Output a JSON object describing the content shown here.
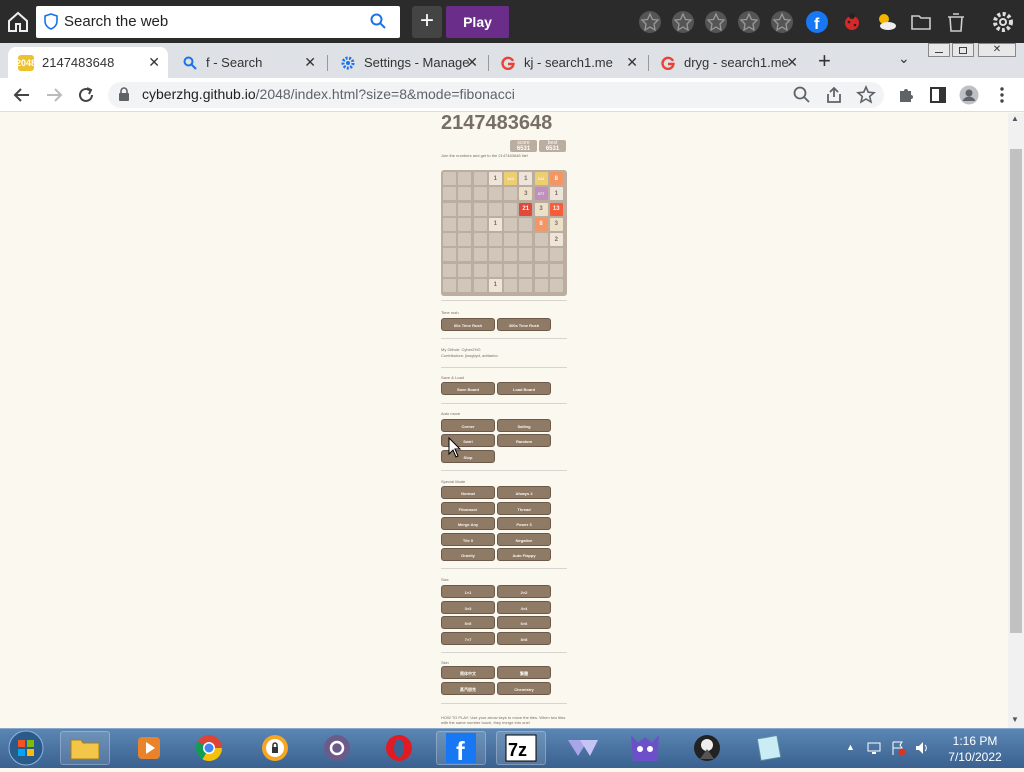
{
  "search_bar": {
    "placeholder": "Search the web",
    "play_label": "Play"
  },
  "tabs": [
    {
      "title": "2147483648",
      "icon": "2048-icon"
    },
    {
      "title": "f - Search",
      "icon": "search-icon"
    },
    {
      "title": "Settings - Manage",
      "icon": "settings-gear-icon"
    },
    {
      "title": "kj - search1.me",
      "icon": "google-icon"
    },
    {
      "title": "dryg - search1.me",
      "icon": "google-icon"
    }
  ],
  "address": {
    "domain": "cyberzhg.github.io",
    "path": "/2048/index.html?size=8&mode=fibonacci"
  },
  "game": {
    "title": "2147483648",
    "score_label": "score",
    "score": "6531",
    "best_label": "best",
    "best": "6531",
    "intro": "Join the numbers and get to the 2147483648 tile!",
    "board_size": 8,
    "tiles": [
      {
        "r": 0,
        "c": 3,
        "v": "1"
      },
      {
        "r": 0,
        "c": 4,
        "v": "144"
      },
      {
        "r": 0,
        "c": 5,
        "v": "1"
      },
      {
        "r": 0,
        "c": 6,
        "v": "144"
      },
      {
        "r": 0,
        "c": 7,
        "v": "8"
      },
      {
        "r": 1,
        "c": 5,
        "v": "3"
      },
      {
        "r": 1,
        "c": 6,
        "v": "377"
      },
      {
        "r": 1,
        "c": 7,
        "v": "1"
      },
      {
        "r": 2,
        "c": 5,
        "v": "21"
      },
      {
        "r": 2,
        "c": 6,
        "v": "3"
      },
      {
        "r": 2,
        "c": 7,
        "v": "13"
      },
      {
        "r": 3,
        "c": 3,
        "v": "1"
      },
      {
        "r": 3,
        "c": 6,
        "v": "8"
      },
      {
        "r": 3,
        "c": 7,
        "v": "3"
      },
      {
        "r": 4,
        "c": 7,
        "v": "2"
      },
      {
        "r": 7,
        "c": 3,
        "v": "1"
      }
    ],
    "time_rush": {
      "label": "Time rush",
      "buttons": [
        "60s Time Rush",
        "300s Time Rush"
      ]
    },
    "github": {
      "line1": "My Github: CyberZHG",
      "line2": "Contributors: jlongbyd, adrianbo"
    },
    "save_load": {
      "label": "Save & Load",
      "buttons": [
        "Save Board",
        "Load Board"
      ]
    },
    "auto_move": {
      "label": "Auto move",
      "buttons": [
        "Corner",
        "Sailing",
        "Swirl",
        "Random",
        "Stop"
      ]
    },
    "special_mode": {
      "label": "Special Mode",
      "buttons": [
        "Normal",
        "Always 2",
        "Fibonacci",
        "Thread",
        "Merge Any",
        "Power 3",
        "Tile 0",
        "Negative",
        "Gravity",
        "Auto Flappy"
      ]
    },
    "size": {
      "label": "Size",
      "buttons": [
        "1×1",
        "2×2",
        "3×3",
        "4×4",
        "5×5",
        "6×6",
        "7×7",
        "8×8"
      ]
    },
    "skin": {
      "label": "Skin",
      "buttons": [
        "简体中文",
        "繁體",
        "蒸汽朋克",
        "Chemistry"
      ]
    },
    "how_to": "HOW TO PLAY: Use your arrow keys to move the tiles. When two tiles with the same number touch, they merge into one!"
  },
  "clock": {
    "time": "1:16 PM",
    "date": "7/10/2022"
  },
  "colors": {
    "tile_bg": "#eee4da",
    "fib_orange": "#f2b179",
    "fib_red": "#f65e3b",
    "fib_purple": "#c28ec2",
    "fib_yellow": "#edcf72"
  }
}
